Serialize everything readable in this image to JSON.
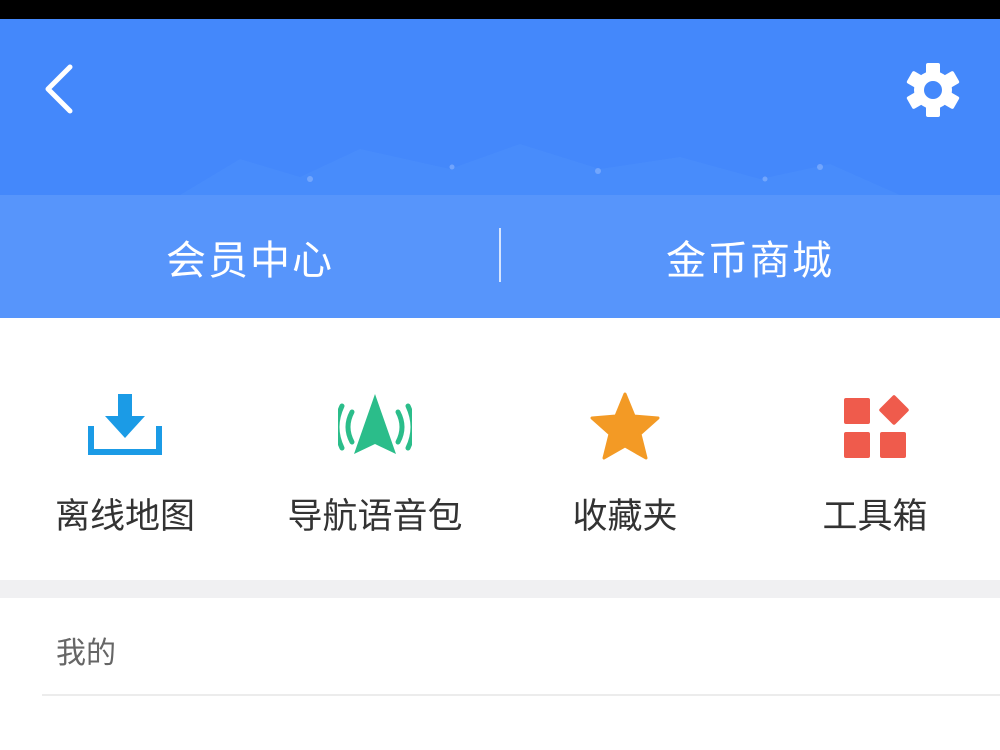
{
  "header": {
    "back_icon": "chevron-left-icon",
    "settings_icon": "gear-icon",
    "background_color": "#4488fb"
  },
  "member_bar": {
    "left_label": "会员中心",
    "right_label": "金币商城",
    "background_color": "#5795fb"
  },
  "shortcuts": [
    {
      "label": "离线地图",
      "icon": "download-icon",
      "color": "#1b9be6"
    },
    {
      "label": "导航语音包",
      "icon": "navigation-voice-icon",
      "color": "#2bbd8a"
    },
    {
      "label": "收藏夹",
      "icon": "star-icon",
      "color": "#f39a25"
    },
    {
      "label": "工具箱",
      "icon": "toolbox-icon",
      "color": "#ef5b4c"
    }
  ],
  "section": {
    "title": "我的"
  }
}
